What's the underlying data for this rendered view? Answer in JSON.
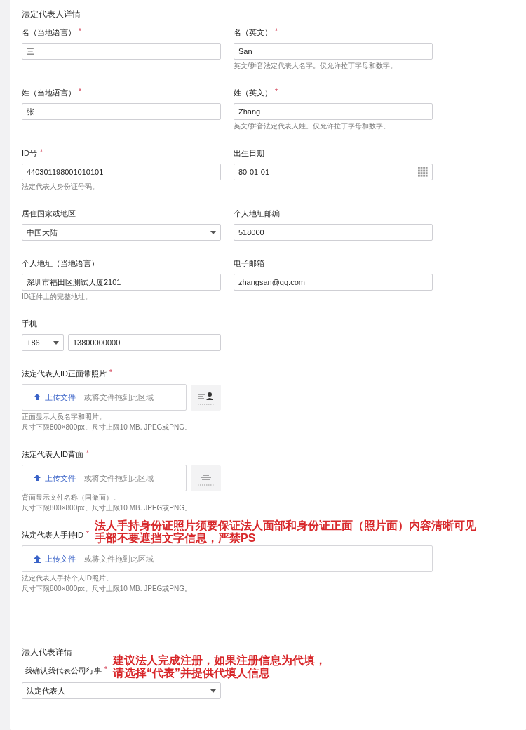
{
  "sections": [
    {
      "title": "法定代表人详情",
      "rows": [
        {
          "fields": [
            {
              "kind": "text",
              "label": "名（当地语言）",
              "required_mark": "*",
              "value": "三"
            },
            {
              "kind": "text",
              "label": "名（英文）",
              "required_mark": "*",
              "value": "San",
              "hint": "英文/拼音法定代表人名字。仅允许拉丁字母和数字。"
            }
          ]
        },
        {
          "fields": [
            {
              "kind": "text",
              "label": "姓（当地语言）",
              "required_mark": "*",
              "value": "张"
            },
            {
              "kind": "text",
              "label": "姓（英文）",
              "required_mark": "*",
              "value": "Zhang",
              "hint": "英文/拼音法定代表人姓。仅允许拉丁字母和数字。"
            }
          ]
        },
        {
          "fields": [
            {
              "kind": "text",
              "label": "ID号",
              "required_mark": "*",
              "value": "440301198001010101",
              "hint": "法定代表人身份证号码。"
            },
            {
              "kind": "date",
              "label": "出生日期",
              "value": "80-01-01"
            }
          ]
        },
        {
          "fields": [
            {
              "kind": "select",
              "label": "居住国家或地区",
              "value": "中国大陆"
            },
            {
              "kind": "text",
              "label": "个人地址邮编",
              "value": "518000"
            }
          ]
        },
        {
          "fields": [
            {
              "kind": "text",
              "label": "个人地址（当地语言）",
              "value": "深圳市福田区测试大厦2101",
              "hint": "ID证件上的完整地址。"
            },
            {
              "kind": "text",
              "label": "电子邮箱",
              "value": "zhangsan@qq.com"
            }
          ]
        },
        {
          "fields": [
            {
              "kind": "phone",
              "label": "手机",
              "code": "+86",
              "value": "13800000000"
            }
          ]
        },
        {
          "fields": [
            {
              "kind": "upload",
              "label": "法定代表人ID正面带照片",
              "required_mark": "*",
              "button": "上传文件",
              "drop_text": "或将文件拖到此区域",
              "sample": {
                "kind": "front"
              },
              "hints": [
                "正面显示人员名字和照片。",
                "尺寸下限800×800px。尺寸上限10 MB. JPEG或PNG。"
              ]
            }
          ]
        },
        {
          "fields": [
            {
              "kind": "upload",
              "label": "法定代表人ID背面",
              "required_mark": "*",
              "button": "上传文件",
              "drop_text": "或将文件拖到此区域",
              "sample": {
                "kind": "back"
              },
              "hints": [
                "背面显示文件名称（国徽面）。",
                "尺寸下限800×800px。尺寸上限10 MB. JPEG或PNG。"
              ]
            }
          ]
        },
        {
          "fields": [
            {
              "kind": "upload",
              "label": "法定代表人手持ID",
              "required_mark": "*",
              "button": "上传文件",
              "drop_text": "或将文件拖到此区域",
              "annotation": [
                "法人手持身份证照片须要保证法人面部和身份证正面（照片面）内容清晰可见",
                "手部不要遮挡文字信息，严禁PS"
              ],
              "hints": [
                "法定代表人手持个人ID照片。",
                "尺寸下限800×800px。尺寸上限10 MB. JPEG或PNG。"
              ]
            }
          ]
        }
      ]
    },
    {
      "title": "法人代表详情",
      "rows": [
        {
          "fields": [
            {
              "kind": "select",
              "label": "我确认我代表公司行事",
              "required_mark": "*",
              "value": "法定代表人",
              "annotation": [
                "建议法人完成注册，如果注册信息为代填，",
                "请选择“代表”并提供代填人信息"
              ]
            }
          ]
        }
      ]
    }
  ]
}
